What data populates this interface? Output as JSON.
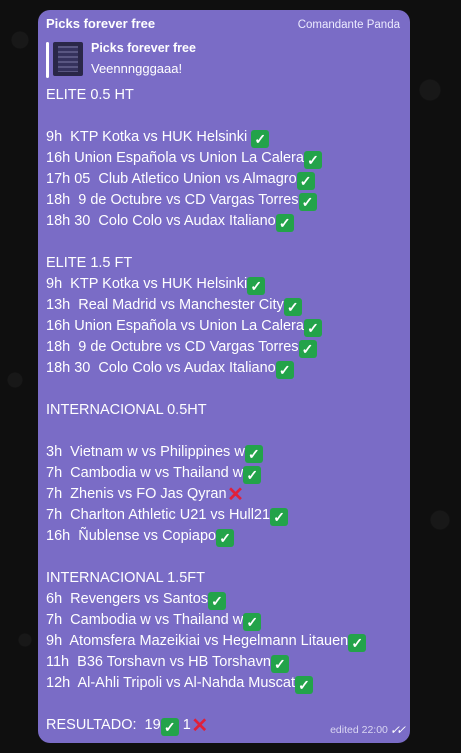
{
  "message": {
    "channel_name": "Picks forever free",
    "author": "Comandante Panda",
    "reply": {
      "title": "Picks forever free",
      "text": "Veennngggaaa!"
    },
    "lines": [
      {
        "text": "ELITE 0.5 HT",
        "mark": ""
      },
      {
        "text": "",
        "mark": ""
      },
      {
        "text": "9h  KTP Kotka vs HUK Helsinki ",
        "mark": "check"
      },
      {
        "text": "16h Union Española vs Union La Calera",
        "mark": "check"
      },
      {
        "text": "17h 05  Club Atletico Union vs Almagro",
        "mark": "check"
      },
      {
        "text": "18h  9 de Octubre vs CD Vargas Torres",
        "mark": "check"
      },
      {
        "text": "18h 30  Colo Colo vs Audax Italiano",
        "mark": "check"
      },
      {
        "text": "",
        "mark": ""
      },
      {
        "text": "ELITE 1.5 FT",
        "mark": ""
      },
      {
        "text": "9h  KTP Kotka vs HUK Helsinki",
        "mark": "check"
      },
      {
        "text": "13h  Real Madrid vs Manchester City",
        "mark": "check"
      },
      {
        "text": "16h Union Española vs Union La Calera",
        "mark": "check"
      },
      {
        "text": "18h  9 de Octubre vs CD Vargas Torres",
        "mark": "check"
      },
      {
        "text": "18h 30  Colo Colo vs Audax Italiano",
        "mark": "check"
      },
      {
        "text": "",
        "mark": ""
      },
      {
        "text": "INTERNACIONAL 0.5HT",
        "mark": ""
      },
      {
        "text": "",
        "mark": ""
      },
      {
        "text": "3h  Vietnam w vs Philippines w",
        "mark": "check"
      },
      {
        "text": "7h  Cambodia w vs Thailand w",
        "mark": "check"
      },
      {
        "text": "7h  Zhenis vs FO Jas Qyran",
        "mark": "cross"
      },
      {
        "text": "7h  Charlton Athletic U21 vs Hull21",
        "mark": "check"
      },
      {
        "text": "16h  Ñublense vs Copiapo",
        "mark": "check"
      },
      {
        "text": "",
        "mark": ""
      },
      {
        "text": "INTERNACIONAL 1.5FT",
        "mark": ""
      },
      {
        "text": "6h  Revengers vs Santos",
        "mark": "check"
      },
      {
        "text": "7h  Cambodia w vs Thailand w",
        "mark": "check"
      },
      {
        "text": "9h  Atomsfera Mazeikiai vs Hegelmann Litauen",
        "mark": "check"
      },
      {
        "text": "11h  B36 Torshavn vs HB Torshavn",
        "mark": "check"
      },
      {
        "text": "12h  Al-Ahli Tripoli vs Al-Nahda Muscat",
        "mark": "check"
      },
      {
        "text": "",
        "mark": ""
      }
    ],
    "result": {
      "label": "RESULTADO:  19",
      "mid": " 1",
      "marks": [
        "check",
        "cross"
      ]
    },
    "edited_time": "edited 22:00",
    "read_ticks": "✓✓"
  },
  "colors": {
    "bubble": "#7a6cc6",
    "check": "#23a34a",
    "cross": "#e0203a"
  },
  "icons": {
    "check": "check-mark-emoji-icon",
    "cross": "cross-mark-emoji-icon",
    "read": "double-check-read-icon"
  }
}
